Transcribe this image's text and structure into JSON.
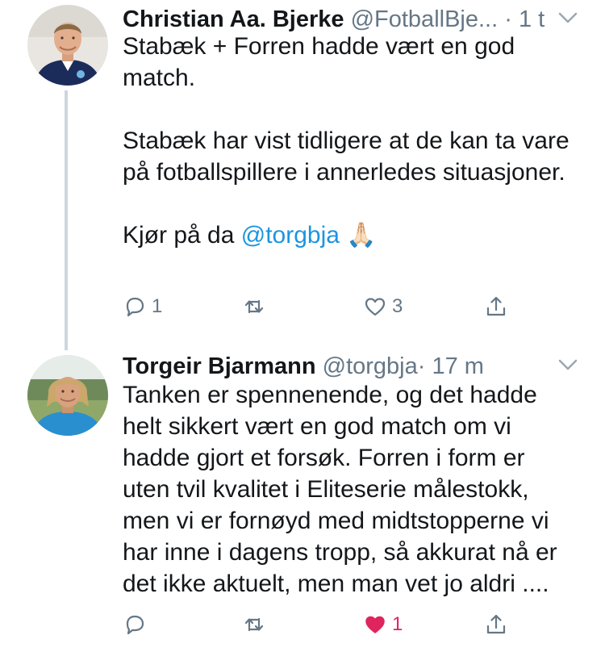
{
  "colors": {
    "text": "#14171a",
    "secondary": "#657786",
    "link": "#1b95e0",
    "like_active": "#e0245e",
    "thread_line": "#ccd6dd"
  },
  "tweets": [
    {
      "author_name": "Christian Aa. Bjerke",
      "handle": "@FotballBje...",
      "separator": "·",
      "time": "1 t",
      "paragraphs": [
        "Stabæk + Forren hadde vært en god match.",
        "Stabæk har vist tidligere at de kan ta vare på fotballspillere i annerledes situasjoner."
      ],
      "last_line_text": "Kjør på da ",
      "last_line_mention": "@torgbja",
      "last_line_emoji": "🙏🏻",
      "reply_count": "1",
      "retweet_count": "",
      "like_count": "3",
      "liked": false
    },
    {
      "author_name": "Torgeir Bjarmann",
      "handle": "@torgbja",
      "separator": "·",
      "time": "17 m",
      "text": "Tanken er spennenende, og det hadde helt sikkert vært en god match om vi hadde gjort et forsøk. Forren i form er uten tvil kvalitet i Eliteserie målestokk, men vi er fornøyd med midtstopperne vi har inne i dagens tropp, så akkurat nå er det ikke aktuelt, men man vet jo aldri ....",
      "reply_count": "",
      "retweet_count": "",
      "like_count": "1",
      "liked": true
    }
  ],
  "icons": {
    "reply": "reply-icon",
    "retweet": "retweet-icon",
    "like": "heart-icon",
    "share": "share-icon",
    "menu": "chevron-down-icon"
  }
}
